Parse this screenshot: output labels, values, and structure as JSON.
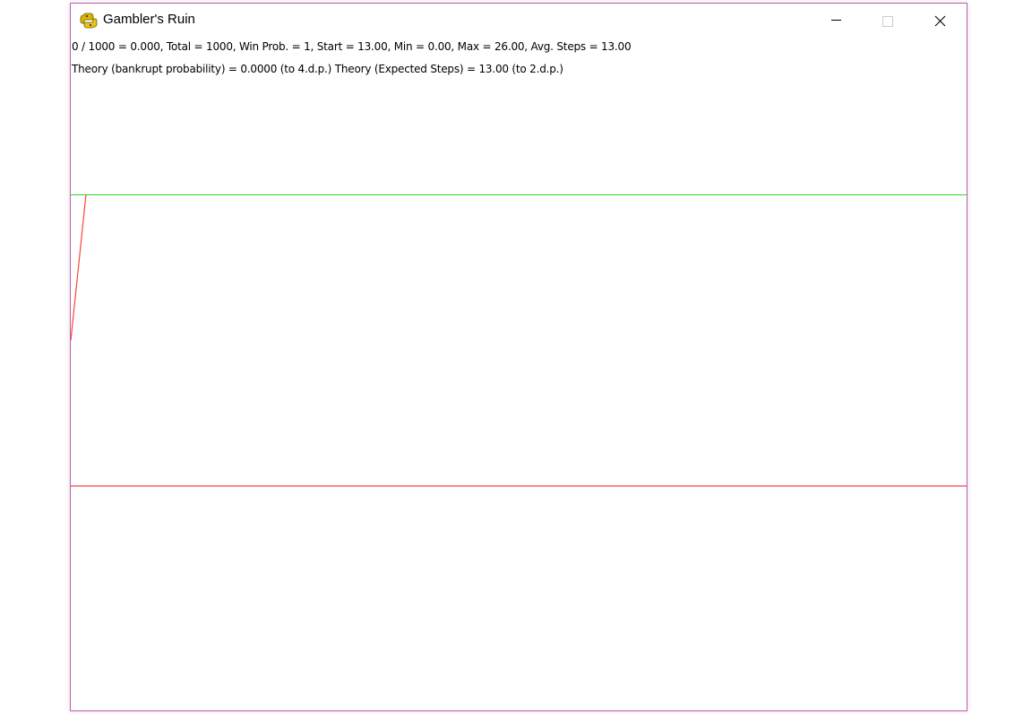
{
  "window": {
    "title": "Gambler's Ruin",
    "icon": "python-snake-icon",
    "controls": {
      "minimize": "minimize-icon",
      "maximize": "maximize-icon",
      "close": "close-icon"
    }
  },
  "stats": {
    "line1": "0 / 1000 = 0.000, Total = 1000, Win Prob. = 1, Start = 13.00, Min = 0.00, Max = 26.00, Avg. Steps = 13.00",
    "line2": "Theory (bankrupt probability) = 0.0000 (to 4.d.p.)  Theory (Expected Steps) = 13.00 (to 2.d.p.)"
  },
  "colors": {
    "border": "#c25ab4",
    "upper_boundary": "#22dd22",
    "lower_boundary": "#ee2222",
    "walk": "#ff4433",
    "background": "#ffffff"
  }
}
